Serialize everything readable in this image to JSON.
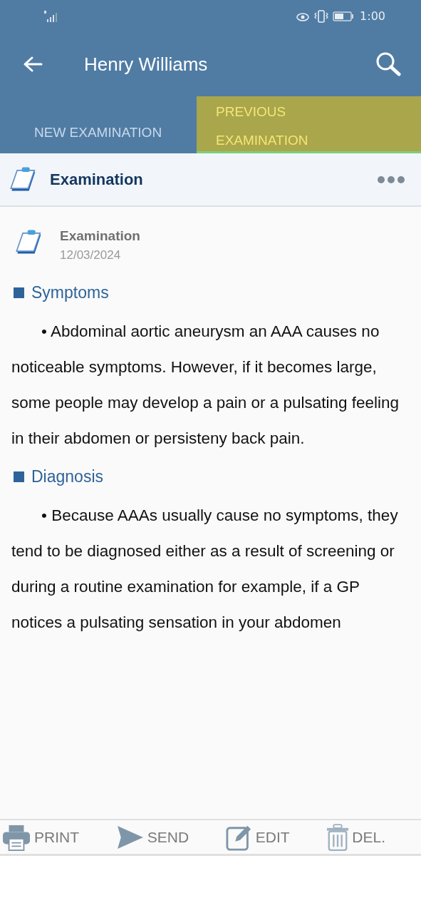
{
  "status_bar": {
    "time": "1:00"
  },
  "app_bar": {
    "title": "Henry Williams"
  },
  "tabs": [
    {
      "label": "NEW EXAMINATION",
      "selected": false
    },
    {
      "label": "PREVIOUS EXAMINATION",
      "selected": true
    }
  ],
  "section_header": {
    "title": "Examination"
  },
  "entry": {
    "title": "Examination",
    "date": "12/03/2024"
  },
  "sections": [
    {
      "heading": "Symptoms",
      "text": "• Abdominal aortic aneurysm an AAA causes no noticeable symptoms. However, if it becomes large, some people may develop a pain or a pulsating feeling in their abdomen or persisteny back pain."
    },
    {
      "heading": "Diagnosis",
      "text": "• Because AAAs usually cause no symptoms, they tend to be diagnosed either as a result of screening or during a routine examination for example, if a GP notices a pulsating sensation in your abdomen"
    }
  ],
  "toolbar": [
    {
      "kind": "print",
      "label": "PRINT"
    },
    {
      "kind": "send",
      "label": "SEND"
    },
    {
      "kind": "edit",
      "label": "EDIT"
    },
    {
      "kind": "delete",
      "label": "DEL."
    }
  ]
}
